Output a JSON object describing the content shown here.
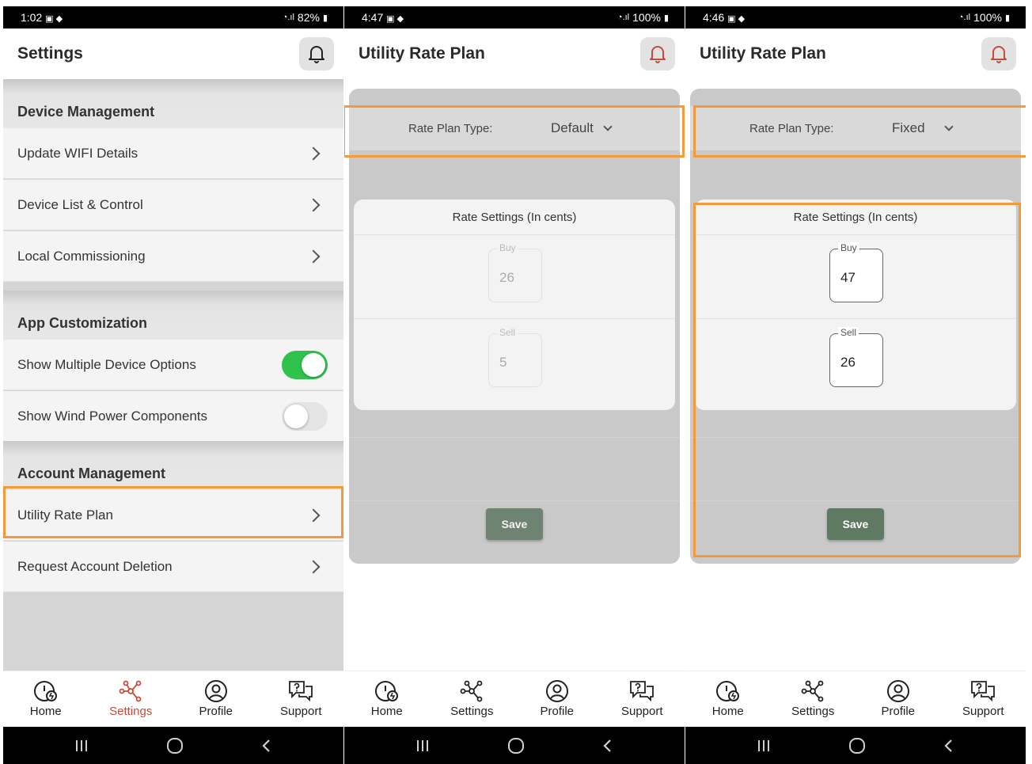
{
  "colors": {
    "highlight": "#f29a3c",
    "toggle_on": "#2fc24c",
    "active_nav": "#c94a3a",
    "save_button": "#6f8372"
  },
  "screens": {
    "settings": {
      "status": {
        "time": "1:02",
        "battery": "82%"
      },
      "title": "Settings",
      "sections": [
        {
          "heading": "Device Management",
          "items": [
            "Update WIFI Details",
            "Device List & Control",
            "Local Commissioning"
          ]
        },
        {
          "heading": "App Customization",
          "toggles": [
            {
              "label": "Show Multiple Device Options",
              "on": true
            },
            {
              "label": "Show Wind Power Components",
              "on": false
            }
          ]
        },
        {
          "heading": "Account Management",
          "items": [
            "Utility Rate Plan",
            "Request Account Deletion"
          ]
        }
      ]
    },
    "rate_default": {
      "status": {
        "time": "4:47",
        "battery": "100%"
      },
      "title": "Utility Rate Plan",
      "type_label": "Rate Plan Type:",
      "type_value": "Default",
      "card_title": "Rate Settings (In cents)",
      "buy_label": "Buy",
      "buy_value": "26",
      "sell_label": "Sell",
      "sell_value": "5",
      "save_label": "Save"
    },
    "rate_fixed": {
      "status": {
        "time": "4:46",
        "battery": "100%"
      },
      "title": "Utility Rate Plan",
      "type_label": "Rate Plan Type:",
      "type_value": "Fixed",
      "card_title": "Rate Settings (In cents)",
      "buy_label": "Buy",
      "buy_value": "47",
      "sell_label": "Sell",
      "sell_value": "26",
      "save_label": "Save"
    }
  },
  "nav": {
    "home": "Home",
    "settings": "Settings",
    "profile": "Profile",
    "support": "Support"
  },
  "icons": {
    "bell": "bell-icon",
    "chevron": "chevron-right-icon",
    "home": "gauge-icon",
    "settings": "network-nodes-icon",
    "profile": "user-circle-icon",
    "support": "chat-help-icon"
  }
}
